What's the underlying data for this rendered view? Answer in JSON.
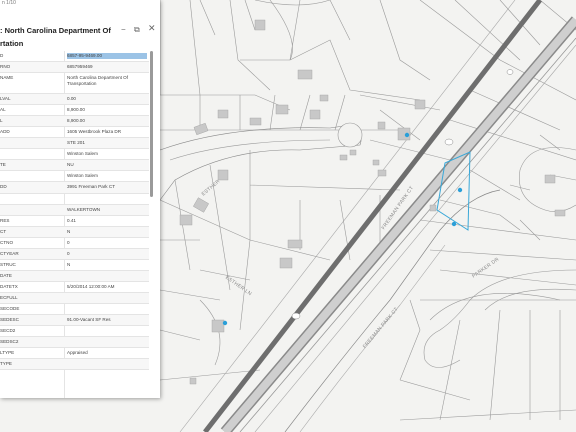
{
  "popup": {
    "top_label": "n 1/10",
    "title_line1": ": North Carolina Department Of",
    "title_line2": "rtation",
    "minimize_icon": "minimize-icon",
    "dock_icon": "dock-icon",
    "close_icon": "close-icon",
    "rows": [
      {
        "key": "D",
        "value": "6857-95-9469.00"
      },
      {
        "key": "RNO",
        "value": "6857959469"
      },
      {
        "key": "NAME",
        "value": "North Carolina Department Of Transportation"
      },
      {
        "key": "LVAL",
        "value": "0.00"
      },
      {
        "key": "AL",
        "value": "8,900.00"
      },
      {
        "key": "L",
        "value": "8,900.00"
      },
      {
        "key": "ADD",
        "value": "1605 Westbrook Plaza DR"
      },
      {
        "key": "",
        "value": "STE 201"
      },
      {
        "key": "",
        "value": "Winston Salem"
      },
      {
        "key": "TE",
        "value": "NU"
      },
      {
        "key": "",
        "value": "Winston Salem"
      },
      {
        "key": "DD",
        "value": "3991 Freeman Park CT"
      },
      {
        "key": "",
        "value": ""
      },
      {
        "key": "",
        "value": "WALKERTOWN"
      },
      {
        "key": "RES",
        "value": "0.41"
      },
      {
        "key": "CT",
        "value": "N"
      },
      {
        "key": "CTNO",
        "value": "0"
      },
      {
        "key": "CTYEAR",
        "value": "0"
      },
      {
        "key": "STRUC",
        "value": "N"
      },
      {
        "key": "DATE",
        "value": ""
      },
      {
        "key": "DATETX",
        "value": "5/20/2014 12:00:00 AM"
      },
      {
        "key": "ECFULL",
        "value": ""
      },
      {
        "key": "SECODE",
        "value": ""
      },
      {
        "key": "SEDESC",
        "value": "91.00-Vacant SF Res"
      },
      {
        "key": "SECD2",
        "value": ""
      },
      {
        "key": "SEDSC2",
        "value": ""
      },
      {
        "key": "LTYPE",
        "value": "Appraised"
      },
      {
        "key": "TYPE",
        "value": ""
      }
    ]
  },
  "map": {
    "streets": [
      "FREEMAN PARK CT",
      "FREEMAN PARK CT",
      "ESTHER",
      "ESTHER LN",
      "PARKER DR"
    ],
    "colors": {
      "background": "#f3f3f1",
      "highway": "#7a7a7a",
      "parcel_lines": "#9a9a9a",
      "selection": "#3aa8d8",
      "points": "#2a9fd8"
    }
  }
}
